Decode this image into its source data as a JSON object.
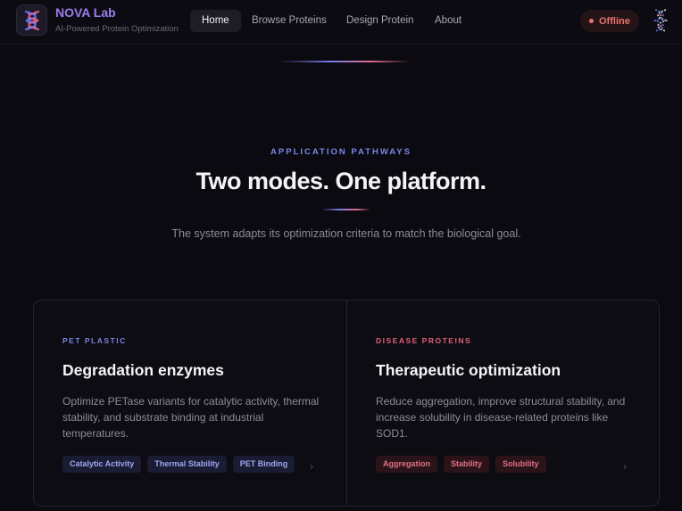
{
  "header": {
    "brand_name": "NOVA Lab",
    "brand_subtitle": "AI-Powered Protein Optimization",
    "nav": [
      {
        "label": "Home",
        "active": true
      },
      {
        "label": "Browse Proteins",
        "active": false
      },
      {
        "label": "Design Protein",
        "active": false
      },
      {
        "label": "About",
        "active": false
      }
    ],
    "status": {
      "label": "Offline",
      "color": "#e9736c"
    },
    "logo_icon": "dna-icon"
  },
  "hero": {
    "eyebrow": "APPLICATION PATHWAYS",
    "headline": "Two modes. One platform.",
    "description": "The system adapts its optimization criteria to match the biological goal."
  },
  "cards": [
    {
      "eyebrow": "PET PLASTIC",
      "title": "Degradation enzymes",
      "description": "Optimize PETase variants for catalytic activity, thermal stability, and substrate binding at industrial temperatures.",
      "tags": [
        "Catalytic Activity",
        "Thermal Stability",
        "PET Binding"
      ],
      "accent": "#7b86e6"
    },
    {
      "eyebrow": "DISEASE PROTEINS",
      "title": "Therapeutic optimization",
      "description": "Reduce aggregation, improve structural stability, and increase solubility in disease-related proteins like SOD1.",
      "tags": [
        "Aggregation",
        "Stability",
        "Solubility"
      ],
      "accent": "#e0607a"
    }
  ],
  "colors": {
    "background": "#0b0a10",
    "brand": "#9b7df0",
    "accent_blue": "#7b86e6",
    "accent_red": "#e0607a"
  }
}
